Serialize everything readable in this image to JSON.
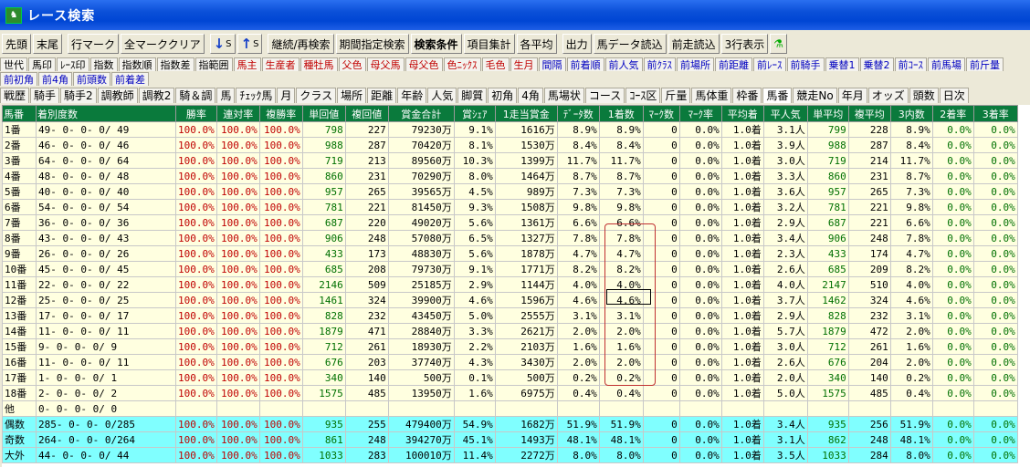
{
  "window": {
    "title": "レース検索",
    "app_icon": "horse-icon"
  },
  "toolbar": [
    {
      "name": "first-button",
      "label": "先頭"
    },
    {
      "name": "last-button",
      "label": "末尾"
    },
    {
      "name": "row-mark-button",
      "label": "行マーク"
    },
    {
      "name": "clear-all-marks-button",
      "label": "全マーククリア"
    },
    {
      "name": "sort-desc-button",
      "arrow": "↓",
      "label": "S"
    },
    {
      "name": "sort-asc-button",
      "arrow": "↑",
      "label": "S"
    },
    {
      "name": "continue-research-button",
      "label": "継続/再検索"
    },
    {
      "name": "period-search-button",
      "label": "期間指定検索"
    },
    {
      "name": "search-conditions-button",
      "label": "検索条件",
      "bold": true
    },
    {
      "name": "item-aggregate-button",
      "label": "項目集計"
    },
    {
      "name": "each-average-button",
      "label": "各平均"
    },
    {
      "name": "output-button",
      "label": "出力"
    },
    {
      "name": "horse-data-load-button",
      "label": "馬データ読込"
    },
    {
      "name": "previous-run-load-button",
      "label": "前走読込"
    },
    {
      "name": "three-row-display-button",
      "label": "3行表示"
    },
    {
      "name": "figure-icon-button",
      "label": "⚗"
    }
  ],
  "tab_rows": [
    [
      {
        "label": "世代"
      },
      {
        "label": "馬印"
      },
      {
        "label": "ﾚｰｽ印"
      },
      {
        "label": "指数"
      },
      {
        "label": "指数順"
      },
      {
        "label": "指数差"
      },
      {
        "label": "指範囲"
      },
      {
        "label": "馬主",
        "color": "red"
      },
      {
        "label": "生産者",
        "color": "red"
      },
      {
        "label": "種牡馬",
        "color": "red"
      },
      {
        "label": "父色",
        "color": "red"
      },
      {
        "label": "母父馬",
        "color": "red"
      },
      {
        "label": "母父色",
        "color": "red"
      },
      {
        "label": "色ﾆｯｸｽ",
        "color": "red"
      },
      {
        "label": "毛色",
        "color": "red"
      },
      {
        "label": "生月",
        "color": "red"
      },
      {
        "label": "間隔",
        "color": "blue"
      },
      {
        "label": "前着順",
        "color": "blue"
      },
      {
        "label": "前人気",
        "color": "blue"
      },
      {
        "label": "前ｸﾗｽ",
        "color": "blue"
      },
      {
        "label": "前場所",
        "color": "blue"
      },
      {
        "label": "前距離",
        "color": "blue"
      },
      {
        "label": "前ﾚｰｽ",
        "color": "blue"
      },
      {
        "label": "前騎手",
        "color": "blue"
      },
      {
        "label": "乗替1",
        "color": "blue"
      },
      {
        "label": "乗替2",
        "color": "blue"
      },
      {
        "label": "前ｺｰｽ",
        "color": "blue"
      },
      {
        "label": "前馬場",
        "color": "blue"
      },
      {
        "label": "前斤量",
        "color": "blue"
      }
    ],
    [
      {
        "label": "前初角",
        "color": "blue"
      },
      {
        "label": "前4角",
        "color": "blue"
      },
      {
        "label": "前頭数",
        "color": "blue"
      },
      {
        "label": "前着差",
        "color": "blue"
      }
    ],
    [
      {
        "label": "戦歴"
      },
      {
        "label": "騎手"
      },
      {
        "label": "騎手2"
      },
      {
        "label": "調教師"
      },
      {
        "label": "調教2"
      },
      {
        "label": "騎＆調"
      },
      {
        "label": "馬"
      },
      {
        "label": "ﾁｪｯｸ馬"
      },
      {
        "label": "月"
      },
      {
        "label": "クラス"
      },
      {
        "label": "場所"
      },
      {
        "label": "距離"
      },
      {
        "label": "年齢"
      },
      {
        "label": "人気"
      },
      {
        "label": "脚質"
      },
      {
        "label": "初角"
      },
      {
        "label": "4角"
      },
      {
        "label": "馬場状"
      },
      {
        "label": "コース"
      },
      {
        "label": "ｺｰｽ区"
      },
      {
        "label": "斤量"
      },
      {
        "label": "馬体重"
      },
      {
        "label": "枠番"
      },
      {
        "label": "馬番",
        "selected": true
      },
      {
        "label": "競走No"
      },
      {
        "label": "年月"
      },
      {
        "label": "オッズ"
      },
      {
        "label": "頭数"
      },
      {
        "label": "日次"
      }
    ]
  ],
  "table": {
    "columns": [
      "馬番",
      "着別度数",
      "勝率",
      "連対率",
      "複勝率",
      "単回値",
      "複回値",
      "賞金合計",
      "賞ｼｪｱ",
      "1走当賞金",
      "ﾃﾞｰﾀ数",
      "1着数",
      "ﾏｰｸ数",
      "ﾏｰｸ率",
      "平均着",
      "平人気",
      "単平均",
      "複平均",
      "3内数",
      "2着率",
      "3着率"
    ],
    "rows": [
      [
        "1番",
        "49- 0- 0- 0/ 49",
        "100.0%",
        "100.0%",
        "100.0%",
        "798",
        "227",
        "79230万",
        "9.1%",
        "1616万",
        "8.9%",
        "8.9%",
        "0",
        "0.0%",
        "1.0着",
        "3.1人",
        "799",
        "228",
        "8.9%",
        "0.0%",
        "0.0%"
      ],
      [
        "2番",
        "46- 0- 0- 0/ 46",
        "100.0%",
        "100.0%",
        "100.0%",
        "988",
        "287",
        "70420万",
        "8.1%",
        "1530万",
        "8.4%",
        "8.4%",
        "0",
        "0.0%",
        "1.0着",
        "3.9人",
        "988",
        "287",
        "8.4%",
        "0.0%",
        "0.0%"
      ],
      [
        "3番",
        "64- 0- 0- 0/ 64",
        "100.0%",
        "100.0%",
        "100.0%",
        "719",
        "213",
        "89560万",
        "10.3%",
        "1399万",
        "11.7%",
        "11.7%",
        "0",
        "0.0%",
        "1.0着",
        "3.0人",
        "719",
        "214",
        "11.7%",
        "0.0%",
        "0.0%"
      ],
      [
        "4番",
        "48- 0- 0- 0/ 48",
        "100.0%",
        "100.0%",
        "100.0%",
        "860",
        "231",
        "70290万",
        "8.0%",
        "1464万",
        "8.7%",
        "8.7%",
        "0",
        "0.0%",
        "1.0着",
        "3.3人",
        "860",
        "231",
        "8.7%",
        "0.0%",
        "0.0%"
      ],
      [
        "5番",
        "40- 0- 0- 0/ 40",
        "100.0%",
        "100.0%",
        "100.0%",
        "957",
        "265",
        "39565万",
        "4.5%",
        "989万",
        "7.3%",
        "7.3%",
        "0",
        "0.0%",
        "1.0着",
        "3.6人",
        "957",
        "265",
        "7.3%",
        "0.0%",
        "0.0%"
      ],
      [
        "6番",
        "54- 0- 0- 0/ 54",
        "100.0%",
        "100.0%",
        "100.0%",
        "781",
        "221",
        "81450万",
        "9.3%",
        "1508万",
        "9.8%",
        "9.8%",
        "0",
        "0.0%",
        "1.0着",
        "3.2人",
        "781",
        "221",
        "9.8%",
        "0.0%",
        "0.0%"
      ],
      [
        "7番",
        "36- 0- 0- 0/ 36",
        "100.0%",
        "100.0%",
        "100.0%",
        "687",
        "220",
        "49020万",
        "5.6%",
        "1361万",
        "6.6%",
        "6.6%",
        "0",
        "0.0%",
        "1.0着",
        "2.9人",
        "687",
        "221",
        "6.6%",
        "0.0%",
        "0.0%"
      ],
      [
        "8番",
        "43- 0- 0- 0/ 43",
        "100.0%",
        "100.0%",
        "100.0%",
        "906",
        "248",
        "57080万",
        "6.5%",
        "1327万",
        "7.8%",
        "7.8%",
        "0",
        "0.0%",
        "1.0着",
        "3.4人",
        "906",
        "248",
        "7.8%",
        "0.0%",
        "0.0%"
      ],
      [
        "9番",
        "26- 0- 0- 0/ 26",
        "100.0%",
        "100.0%",
        "100.0%",
        "433",
        "173",
        "48830万",
        "5.6%",
        "1878万",
        "4.7%",
        "4.7%",
        "0",
        "0.0%",
        "1.0着",
        "2.3人",
        "433",
        "174",
        "4.7%",
        "0.0%",
        "0.0%"
      ],
      [
        "10番",
        "45- 0- 0- 0/ 45",
        "100.0%",
        "100.0%",
        "100.0%",
        "685",
        "208",
        "79730万",
        "9.1%",
        "1771万",
        "8.2%",
        "8.2%",
        "0",
        "0.0%",
        "1.0着",
        "2.6人",
        "685",
        "209",
        "8.2%",
        "0.0%",
        "0.0%"
      ],
      [
        "11番",
        "22- 0- 0- 0/ 22",
        "100.0%",
        "100.0%",
        "100.0%",
        "2146",
        "509",
        "25185万",
        "2.9%",
        "1144万",
        "4.0%",
        "4.0%",
        "0",
        "0.0%",
        "1.0着",
        "4.0人",
        "2147",
        "510",
        "4.0%",
        "0.0%",
        "0.0%"
      ],
      [
        "12番",
        "25- 0- 0- 0/ 25",
        "100.0%",
        "100.0%",
        "100.0%",
        "1461",
        "324",
        "39900万",
        "4.6%",
        "1596万",
        "4.6%",
        "4.6%",
        "0",
        "0.0%",
        "1.0着",
        "3.7人",
        "1462",
        "324",
        "4.6%",
        "0.0%",
        "0.0%"
      ],
      [
        "13番",
        "17- 0- 0- 0/ 17",
        "100.0%",
        "100.0%",
        "100.0%",
        "828",
        "232",
        "43450万",
        "5.0%",
        "2555万",
        "3.1%",
        "3.1%",
        "0",
        "0.0%",
        "1.0着",
        "2.9人",
        "828",
        "232",
        "3.1%",
        "0.0%",
        "0.0%"
      ],
      [
        "14番",
        "11- 0- 0- 0/ 11",
        "100.0%",
        "100.0%",
        "100.0%",
        "1879",
        "471",
        "28840万",
        "3.3%",
        "2621万",
        "2.0%",
        "2.0%",
        "0",
        "0.0%",
        "1.0着",
        "5.7人",
        "1879",
        "472",
        "2.0%",
        "0.0%",
        "0.0%"
      ],
      [
        "15番",
        "9- 0- 0- 0/ 9",
        "100.0%",
        "100.0%",
        "100.0%",
        "712",
        "261",
        "18930万",
        "2.2%",
        "2103万",
        "1.6%",
        "1.6%",
        "0",
        "0.0%",
        "1.0着",
        "3.0人",
        "712",
        "261",
        "1.6%",
        "0.0%",
        "0.0%"
      ],
      [
        "16番",
        "11- 0- 0- 0/ 11",
        "100.0%",
        "100.0%",
        "100.0%",
        "676",
        "203",
        "37740万",
        "4.3%",
        "3430万",
        "2.0%",
        "2.0%",
        "0",
        "0.0%",
        "1.0着",
        "2.6人",
        "676",
        "204",
        "2.0%",
        "0.0%",
        "0.0%"
      ],
      [
        "17番",
        "1- 0- 0- 0/ 1",
        "100.0%",
        "100.0%",
        "100.0%",
        "340",
        "140",
        "500万",
        "0.1%",
        "500万",
        "0.2%",
        "0.2%",
        "0",
        "0.0%",
        "1.0着",
        "2.0人",
        "340",
        "140",
        "0.2%",
        "0.0%",
        "0.0%"
      ],
      [
        "18番",
        "2- 0- 0- 0/ 2",
        "100.0%",
        "100.0%",
        "100.0%",
        "1575",
        "485",
        "13950万",
        "1.6%",
        "6975万",
        "0.4%",
        "0.4%",
        "0",
        "0.0%",
        "1.0着",
        "5.0人",
        "1575",
        "485",
        "0.4%",
        "0.0%",
        "0.0%"
      ],
      [
        "他",
        "0- 0- 0- 0/ 0",
        "",
        "",
        "",
        "",
        "",
        "",
        "",
        "",
        "",
        "",
        "",
        "",
        "",
        "",
        "",
        "",
        "",
        "",
        ""
      ]
    ],
    "summary_rows": [
      [
        "偶数",
        "285- 0- 0- 0/285",
        "100.0%",
        "100.0%",
        "100.0%",
        "935",
        "255",
        "479400万",
        "54.9%",
        "1682万",
        "51.9%",
        "51.9%",
        "0",
        "0.0%",
        "1.0着",
        "3.4人",
        "935",
        "256",
        "51.9%",
        "0.0%",
        "0.0%"
      ],
      [
        "奇数",
        "264- 0- 0- 0/264",
        "100.0%",
        "100.0%",
        "100.0%",
        "861",
        "248",
        "394270万",
        "45.1%",
        "1493万",
        "48.1%",
        "48.1%",
        "0",
        "0.0%",
        "1.0着",
        "3.1人",
        "862",
        "248",
        "48.1%",
        "0.0%",
        "0.0%"
      ],
      [
        "大外",
        "44- 0- 0- 0/ 44",
        "100.0%",
        "100.0%",
        "100.0%",
        "1033",
        "283",
        "100010万",
        "11.4%",
        "2272万",
        "8.0%",
        "8.0%",
        "0",
        "0.0%",
        "1.0着",
        "3.5人",
        "1033",
        "284",
        "8.0%",
        "0.0%",
        "0.0%"
      ]
    ]
  },
  "colors": {
    "header_bg": "#0a7a3c",
    "cell_bg": "#ffffe0",
    "summary_bg": "#80ffff",
    "red_text": "#c00000",
    "blue_text": "#0000c0",
    "green_text": "#007000"
  }
}
